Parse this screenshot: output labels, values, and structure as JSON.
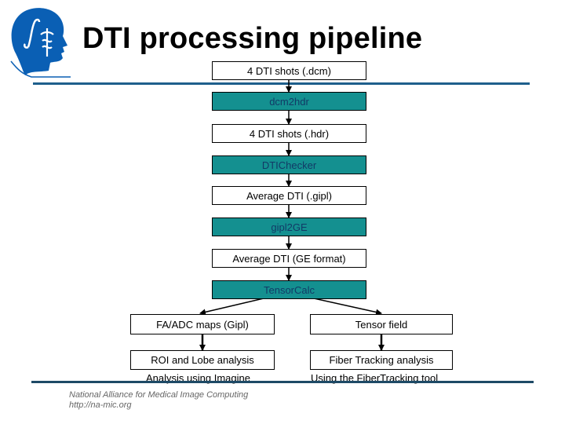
{
  "header": {
    "title": "DTI processing pipeline",
    "logo_icon": "head-with-integral-and-caduceus-logo"
  },
  "colors": {
    "rule": "#1e5f8c",
    "process_box_fill": "#149090",
    "process_box_text": "#123a66",
    "logo_blue": "#0a5fb4"
  },
  "pipeline": {
    "main": [
      {
        "label": "4 DTI shots (.dcm)",
        "kind": "data"
      },
      {
        "label": "dcm2hdr",
        "kind": "process"
      },
      {
        "label": "4 DTI shots (.hdr)",
        "kind": "data"
      },
      {
        "label": "DTIChecker",
        "kind": "process"
      },
      {
        "label": "Average DTI (.gipl)",
        "kind": "data"
      },
      {
        "label": "gipl2GE",
        "kind": "process"
      },
      {
        "label": "Average DTI (GE format)",
        "kind": "data"
      },
      {
        "label": "TensorCalc",
        "kind": "process"
      }
    ],
    "left_branch": {
      "output": "FA/ADC maps (Gipl)",
      "analysis": "ROI and Lobe analysis",
      "caption": "Analysis using Imagine"
    },
    "right_branch": {
      "output": "Tensor field",
      "analysis": "Fiber Tracking analysis",
      "caption": "Using the FiberTracking tool"
    }
  },
  "footer": {
    "line1": "National Alliance for Medical Image Computing",
    "line2": "http://na-mic.org"
  }
}
